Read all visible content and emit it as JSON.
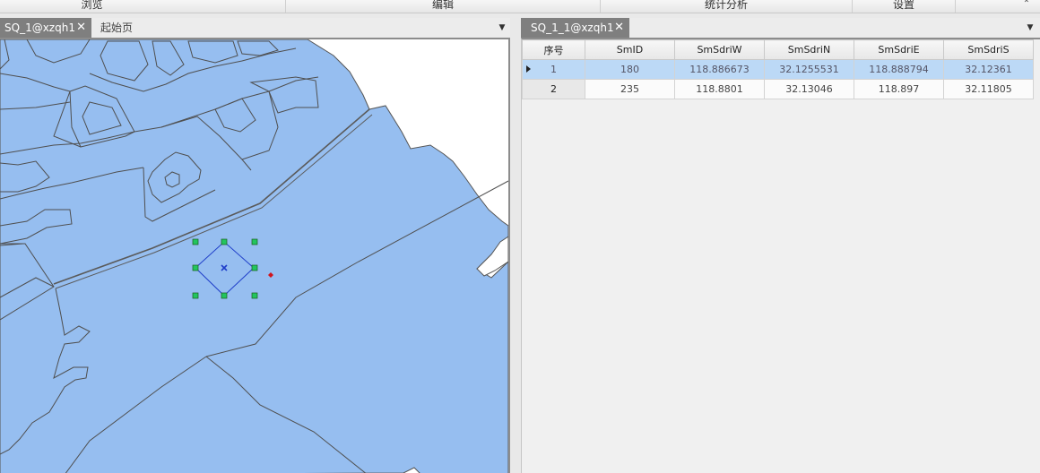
{
  "ribbon": {
    "groups": [
      "浏览",
      "编辑",
      "统计分析",
      "设置"
    ],
    "collapse_icon": "chevron-up-icon"
  },
  "map_pane": {
    "tabs": [
      {
        "label": "SQ_1@xzqh1",
        "active": true
      },
      {
        "label": "起始页",
        "active": false
      }
    ],
    "colors": {
      "region_fill": "#96bef0",
      "boundary": "#4f4f4f",
      "background": "#ffffff",
      "selection_outline": "#1f3ec9",
      "handle_fill": "#22c55e",
      "center_marker": "#1f3ec9",
      "anchor_marker": "#d0141c"
    }
  },
  "table_pane": {
    "tabs": [
      {
        "label": "SQ_1_1@xzqh1",
        "active": true
      }
    ],
    "columns": [
      "序号",
      "SmID",
      "SmSdriW",
      "SmSdriN",
      "SmSdriE",
      "SmSdriS"
    ],
    "rows": [
      {
        "index": "1",
        "cells": [
          "180",
          "118.886673",
          "32.1255531",
          "118.888794",
          "32.12361"
        ],
        "selected": true
      },
      {
        "index": "2",
        "cells": [
          "235",
          "118.8801",
          "32.13046",
          "118.897",
          "32.11805"
        ],
        "selected": false
      }
    ]
  }
}
